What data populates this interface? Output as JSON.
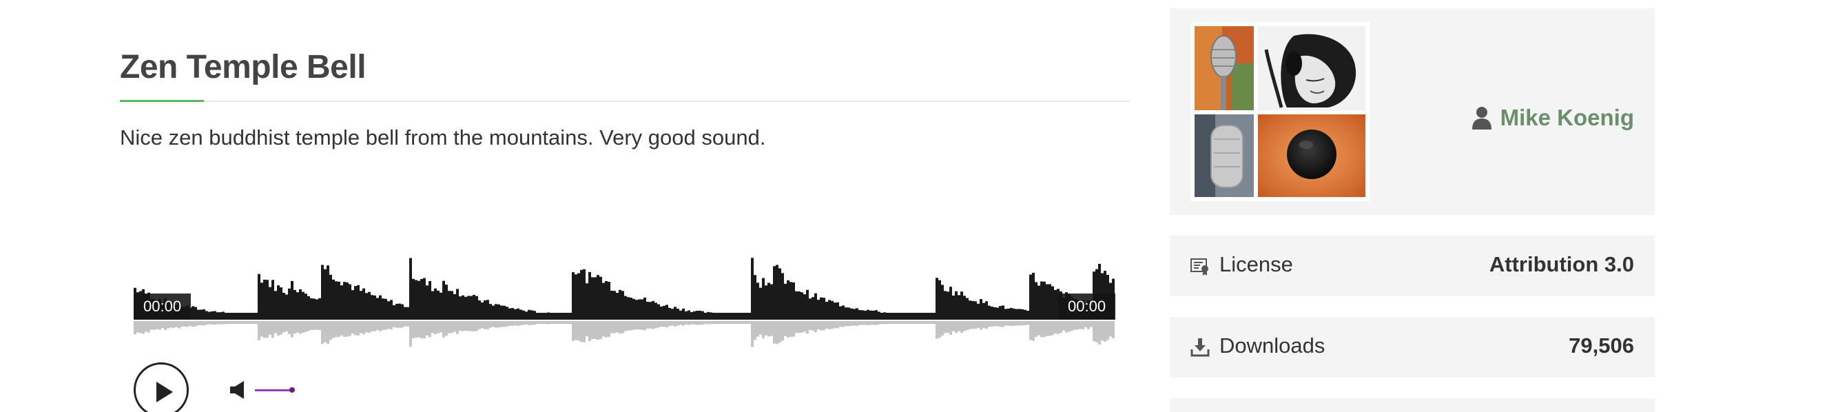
{
  "sound": {
    "title": "Zen Temple Bell",
    "description": "Nice zen buddhist temple bell from the mountains. Very good sound."
  },
  "player": {
    "current_time": "00:00",
    "duration": "00:00",
    "volume_level": 1.0,
    "accent_color": "#9b3bb5"
  },
  "author": {
    "name": "Mike Koenig",
    "icon": "user-icon"
  },
  "details": {
    "license_label": "License",
    "license_value": "Attribution 3.0",
    "license_icon": "license-icon",
    "downloads_label": "Downloads",
    "downloads_value": "79,506",
    "downloads_icon": "download-icon"
  },
  "colors": {
    "title_underline": "#5cb85c",
    "author_link": "#6b8e6b",
    "card_background": "#f4f4f4"
  }
}
